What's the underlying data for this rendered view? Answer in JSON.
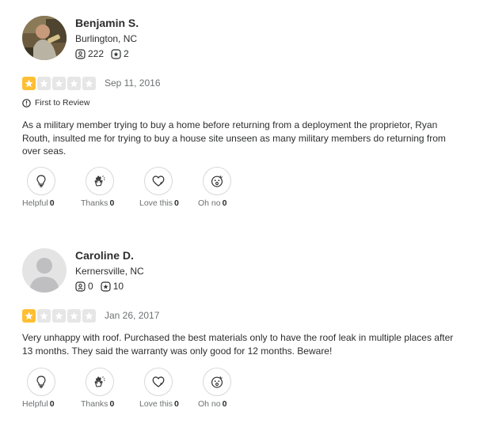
{
  "reviews": [
    {
      "user_name": "Benjamin S.",
      "location": "Burlington, NC",
      "friends_count": "222",
      "reviews_count": "2",
      "rating": 1,
      "max_rating": 5,
      "date": "Sep 11, 2016",
      "badge": "First to Review",
      "text": "As a military member trying to buy a home before returning from a deployment the proprietor, Ryan Routh, insulted me for trying to buy a house site unseen as many military members do returning from over seas.",
      "reactions": [
        {
          "label": "Helpful",
          "count": "0",
          "icon": "lightbulb-icon"
        },
        {
          "label": "Thanks",
          "count": "0",
          "icon": "clapping-hands-icon"
        },
        {
          "label": "Love this",
          "count": "0",
          "icon": "heart-icon"
        },
        {
          "label": "Oh no",
          "count": "0",
          "icon": "surprised-face-icon"
        }
      ]
    },
    {
      "user_name": "Caroline D.",
      "location": "Kernersville, NC",
      "friends_count": "0",
      "reviews_count": "10",
      "rating": 1,
      "max_rating": 5,
      "date": "Jan 26, 2017",
      "text": "Very unhappy with roof. Purchased the best materials only to have the roof leak in multiple places after 13 months. They said the warranty was only good for 12 months. Beware!",
      "reactions": [
        {
          "label": "Helpful",
          "count": "0",
          "icon": "lightbulb-icon"
        },
        {
          "label": "Thanks",
          "count": "0",
          "icon": "clapping-hands-icon"
        },
        {
          "label": "Love this",
          "count": "0",
          "icon": "heart-icon"
        },
        {
          "label": "Oh no",
          "count": "0",
          "icon": "surprised-face-icon"
        }
      ]
    }
  ],
  "colors": {
    "star_filled": "#ffbf33",
    "star_empty": "#e6e6e6",
    "text": "#2d2e2f",
    "muted": "#6e7072"
  }
}
